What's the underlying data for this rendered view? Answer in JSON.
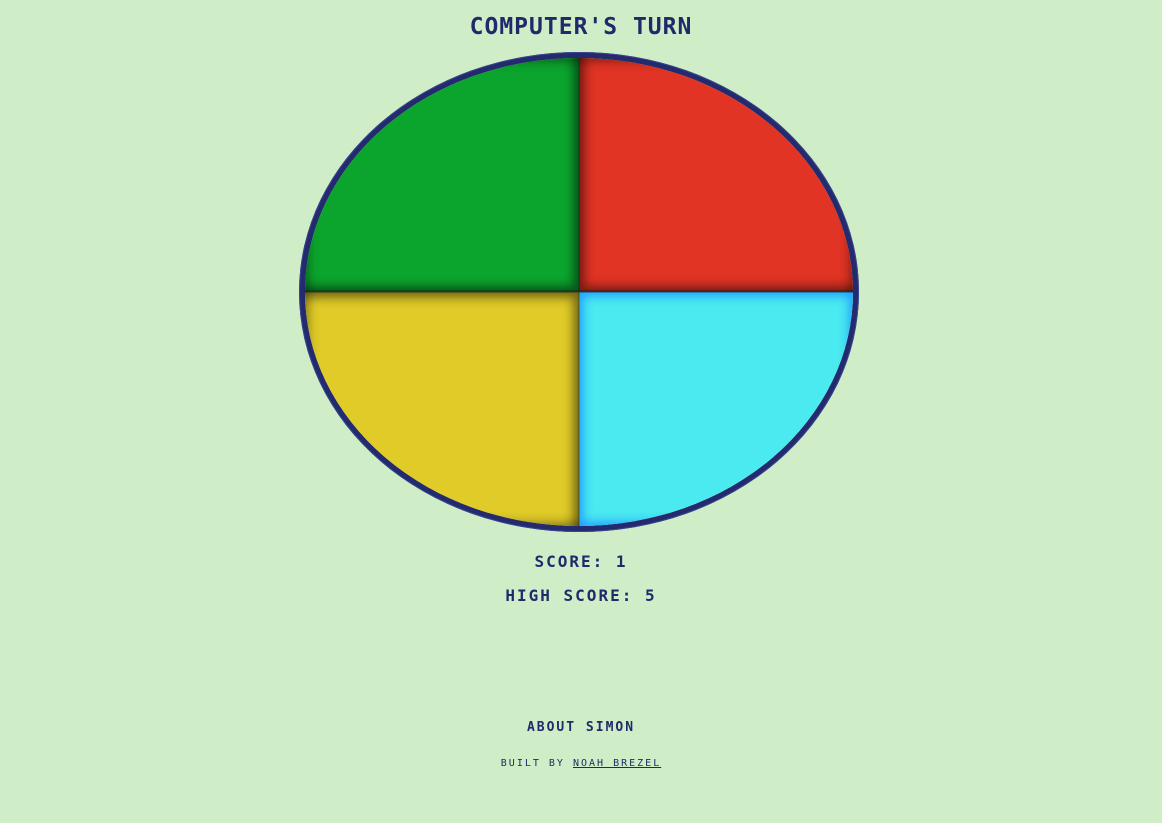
{
  "status": {
    "turn_text": "Computer's Turn"
  },
  "board": {
    "pads": [
      {
        "name": "green",
        "color": "#0ba52e",
        "lit": false
      },
      {
        "name": "red",
        "color": "#e13424",
        "lit": false
      },
      {
        "name": "yellow",
        "color": "#e0cb28",
        "lit": false
      },
      {
        "name": "blue",
        "color": "#4aeaf0",
        "lit": true
      }
    ],
    "rim_color": "#232a6e"
  },
  "scores": {
    "score_text": "Score: 1",
    "high_score_text": "High Score: 5"
  },
  "footer": {
    "about_label": "About Simon",
    "built_by_prefix": "Built by",
    "author_link": "Noah Brezel"
  },
  "colors": {
    "background": "#cfeec7",
    "text": "#1f2a6b"
  }
}
